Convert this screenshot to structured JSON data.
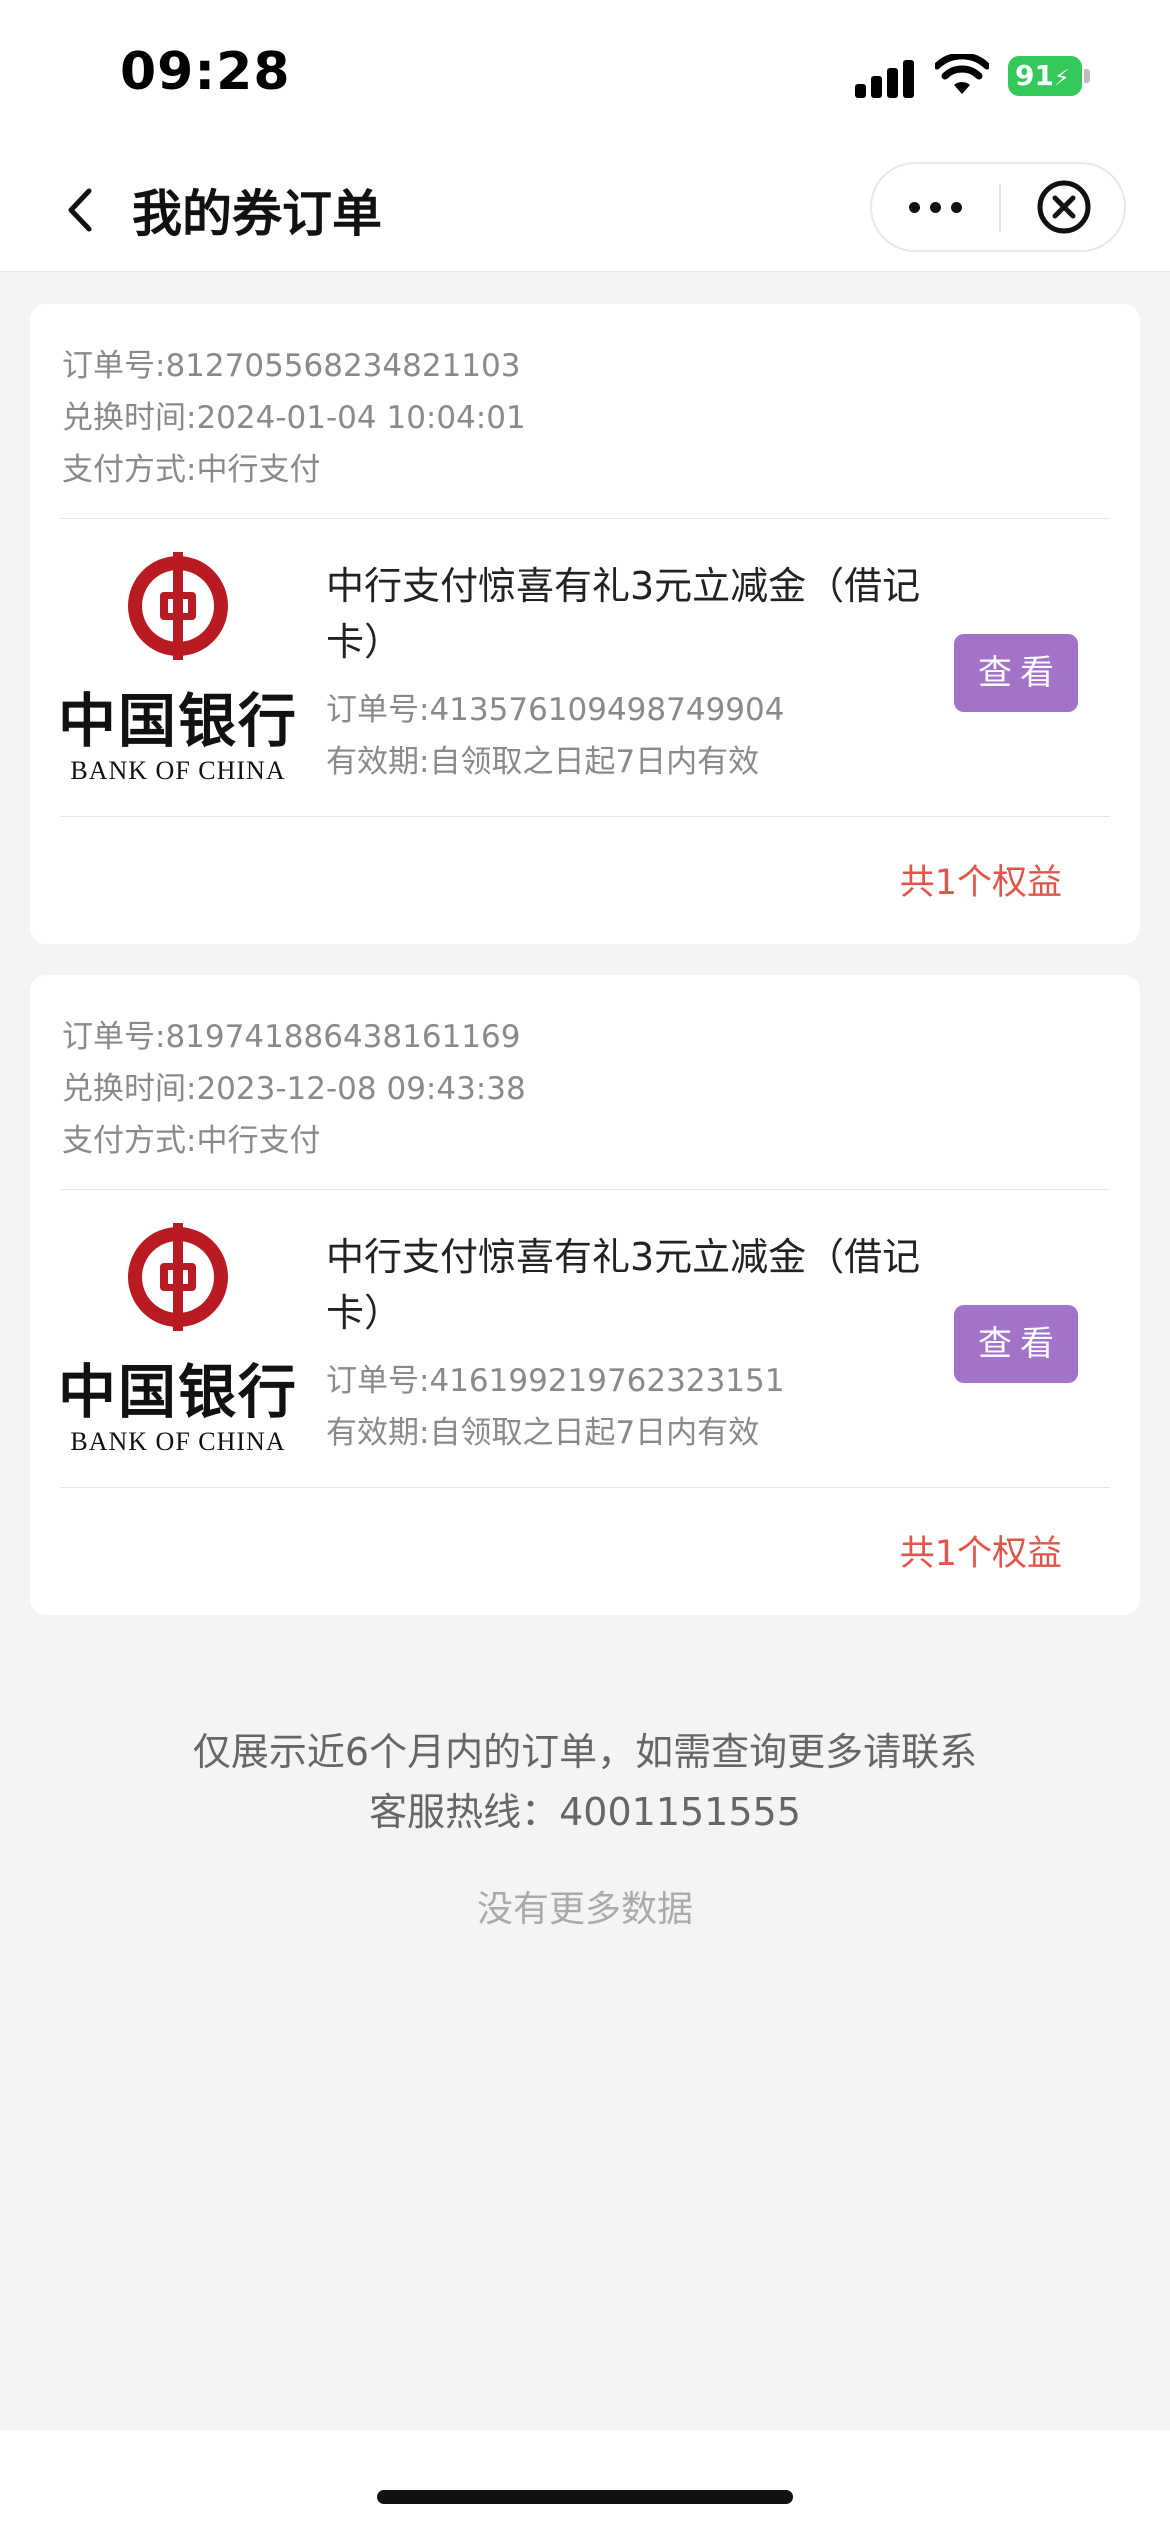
{
  "status_bar": {
    "time": "09:28",
    "battery": "91"
  },
  "nav": {
    "title": "我的券订单"
  },
  "orders": [
    {
      "order_no_label": "订单号:",
      "order_no": "812705568234821103",
      "exchange_time_label": "兑换时间:",
      "exchange_time": "2024-01-04 10:04:01",
      "pay_method_label": "支付方式:",
      "pay_method": "中行支付",
      "logo_cn": "中国银行",
      "logo_en": "BANK OF CHINA",
      "product_title": "中行支付惊喜有礼3元立减金（借记卡）",
      "item_order_label": "订单号:",
      "item_order_no": "413576109498749904",
      "validity_label": "有效期:",
      "validity": "自领取之日起7日内有效",
      "view_label": "查看",
      "benefit_count": "共1个权益"
    },
    {
      "order_no_label": "订单号:",
      "order_no": "819741886438161169",
      "exchange_time_label": "兑换时间:",
      "exchange_time": "2023-12-08 09:43:38",
      "pay_method_label": "支付方式:",
      "pay_method": "中行支付",
      "logo_cn": "中国银行",
      "logo_en": "BANK OF CHINA",
      "product_title": "中行支付惊喜有礼3元立减金（借记卡）",
      "item_order_label": "订单号:",
      "item_order_no": "416199219762323151",
      "validity_label": "有效期:",
      "validity": "自领取之日起7日内有效",
      "view_label": "查看",
      "benefit_count": "共1个权益"
    }
  ],
  "footer": {
    "notice_line1": "仅展示近6个月内的订单，如需查询更多请联系",
    "notice_line2": "客服热线：4001151555",
    "no_more": "没有更多数据"
  },
  "colors": {
    "accent_purple": "#a372c9",
    "count_red": "#e0564a",
    "boc_red": "#b81c22",
    "battery_green": "#34c759"
  }
}
